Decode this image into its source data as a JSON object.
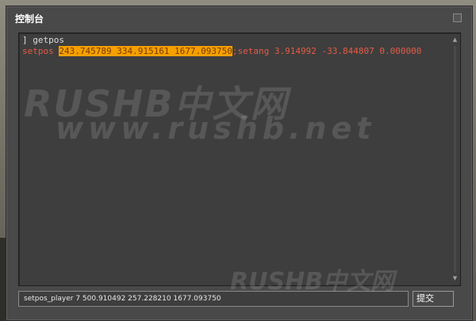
{
  "window": {
    "title": "控制台"
  },
  "console": {
    "command_line": "] getpos",
    "output": {
      "prefix": "setpos ",
      "highlighted": "243.745789 334.915161 1677.093750",
      "suffix": ";setang 3.914992 -33.844807 0.000000"
    }
  },
  "input": {
    "value": "setpos_player 7 500.910492 257.228210 1677.093750"
  },
  "submit": {
    "label": "提交"
  },
  "watermark": {
    "brand": "RUSHB中文网",
    "url": "www.rushb.net"
  },
  "colors": {
    "window_bg": "#494949",
    "console_bg": "#3e3e3e",
    "output_text": "#e65a45",
    "highlight": "#f5a000"
  }
}
